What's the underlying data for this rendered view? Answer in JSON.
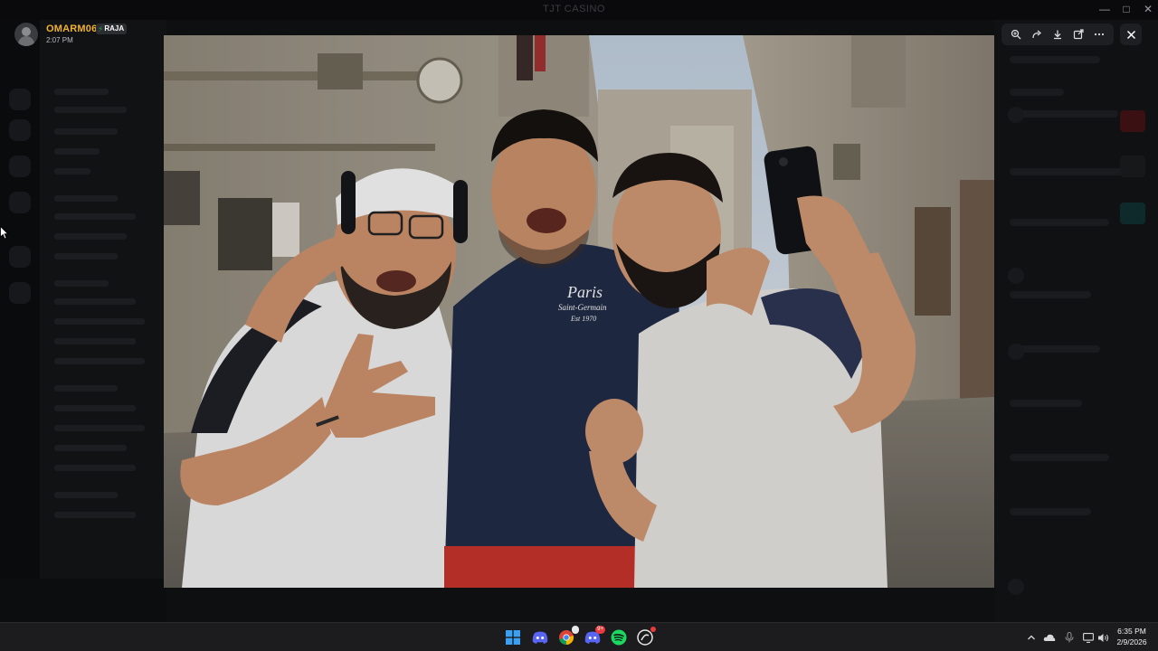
{
  "window": {
    "app_title": "TJT CASINO",
    "minimize_icon": "minimize-icon",
    "maximize_icon": "maximize-icon",
    "close_icon": "close-icon"
  },
  "viewer": {
    "author": {
      "username": "OMARM06",
      "tag": "RAJA",
      "tag_icon": "bolt-icon",
      "timestamp": "2:07 PM"
    },
    "toolbar": [
      {
        "name": "zoom-icon"
      },
      {
        "name": "forward-icon"
      },
      {
        "name": "download-icon"
      },
      {
        "name": "open-external-icon"
      },
      {
        "name": "more-icon"
      }
    ],
    "close_icon": "close-icon",
    "image": {
      "shirt_text": [
        "Paris",
        "Saint-Germain",
        "Est 1970"
      ]
    }
  },
  "colors": {
    "username": "#f0b232",
    "tag_bolt": "#23a55a",
    "taskbar_bg": "#1c1c1e",
    "notification_badge": "#e93b3b"
  },
  "taskbar": {
    "apps": [
      {
        "name": "windows-start-icon"
      },
      {
        "name": "discord-icon"
      },
      {
        "name": "chrome-icon"
      },
      {
        "name": "discord-notification-icon",
        "badge": "9+"
      },
      {
        "name": "spotify-icon"
      },
      {
        "name": "github-desktop-icon"
      }
    ],
    "tray": [
      {
        "name": "chevron-up-icon"
      },
      {
        "name": "onedrive-icon"
      },
      {
        "name": "microphone-icon"
      },
      {
        "name": "display-icon"
      },
      {
        "name": "volume-icon"
      }
    ],
    "time": "6:35 PM",
    "date": "2/9/2026"
  }
}
